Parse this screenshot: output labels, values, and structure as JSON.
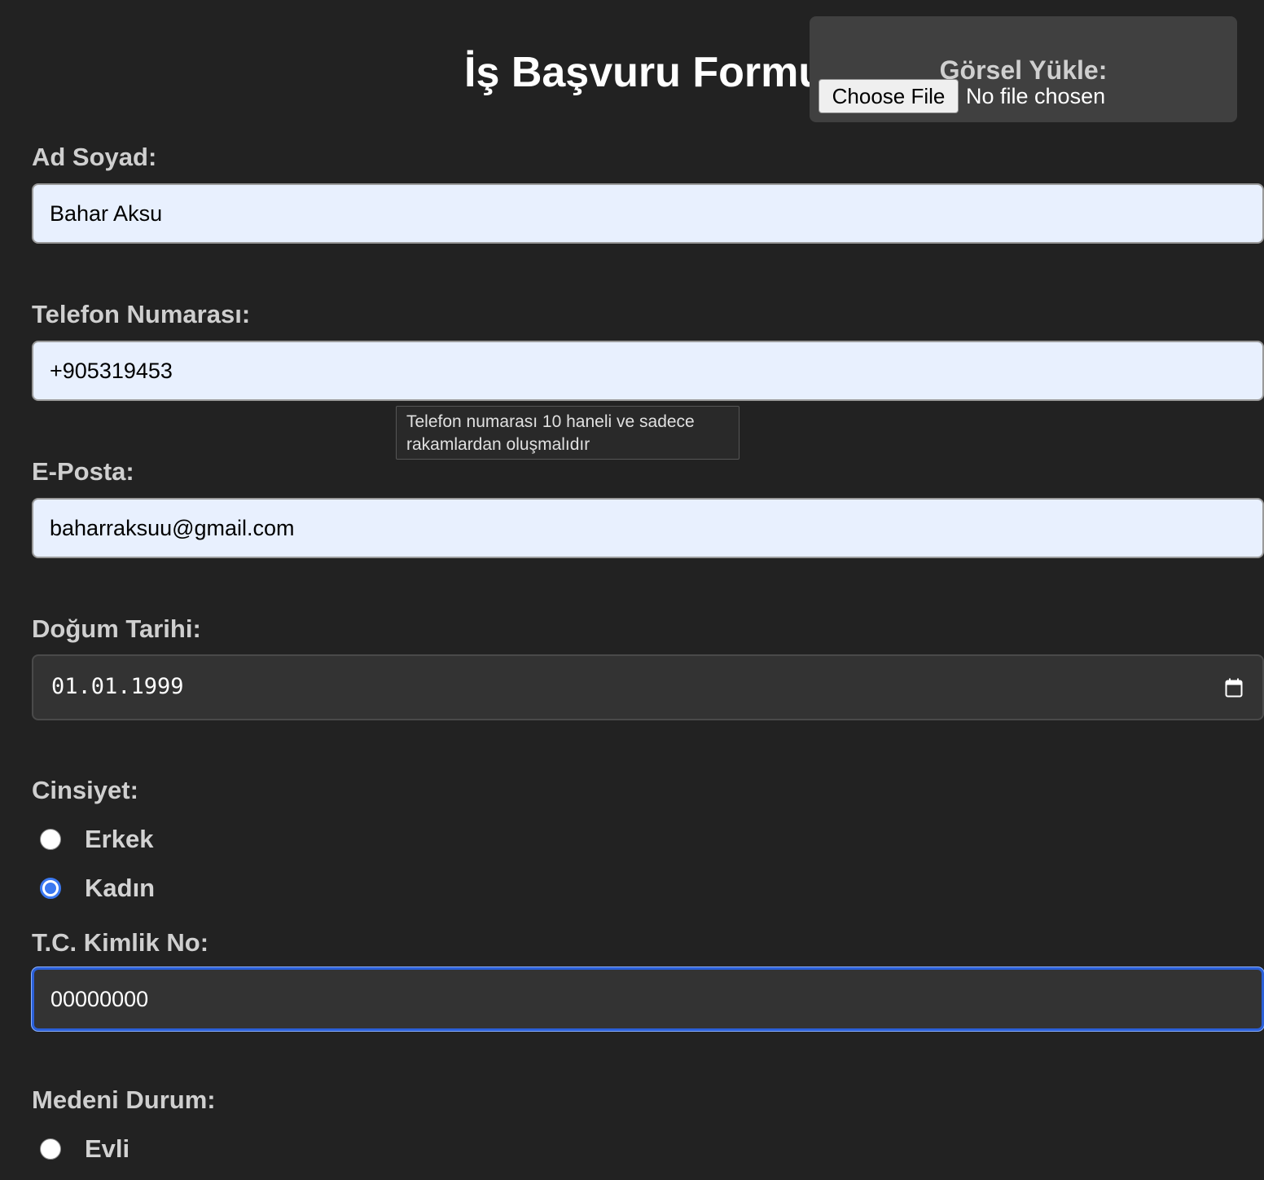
{
  "page": {
    "title": "İş Başvuru Formu"
  },
  "upload": {
    "label": "Görsel Yükle:",
    "button_label": "Choose File",
    "status": "No file chosen"
  },
  "form": {
    "name": {
      "label": "Ad Soyad:",
      "value": "Bahar Aksu"
    },
    "phone": {
      "label": "Telefon Numarası:",
      "value": "+905319453",
      "tooltip": "Telefon numarası 10 haneli ve sadece rakamlardan oluşmalıdır"
    },
    "email": {
      "label": "E-Posta:",
      "value": "baharraksuu@gmail.com"
    },
    "birthdate": {
      "label": "Doğum Tarihi:",
      "value": "01.01.1999",
      "icon": "calendar-icon"
    },
    "gender": {
      "label": "Cinsiyet:",
      "options": [
        "Erkek",
        "Kadın"
      ],
      "selected": "Kadın"
    },
    "tc_no": {
      "label": "T.C. Kimlik No:",
      "value": "00000000"
    },
    "marital": {
      "label": "Medeni Durum:",
      "options": [
        "Evli"
      ]
    }
  },
  "colors": {
    "background": "#222222",
    "accent": "#3b78f0",
    "input_autofill": "#e8f0fe"
  }
}
